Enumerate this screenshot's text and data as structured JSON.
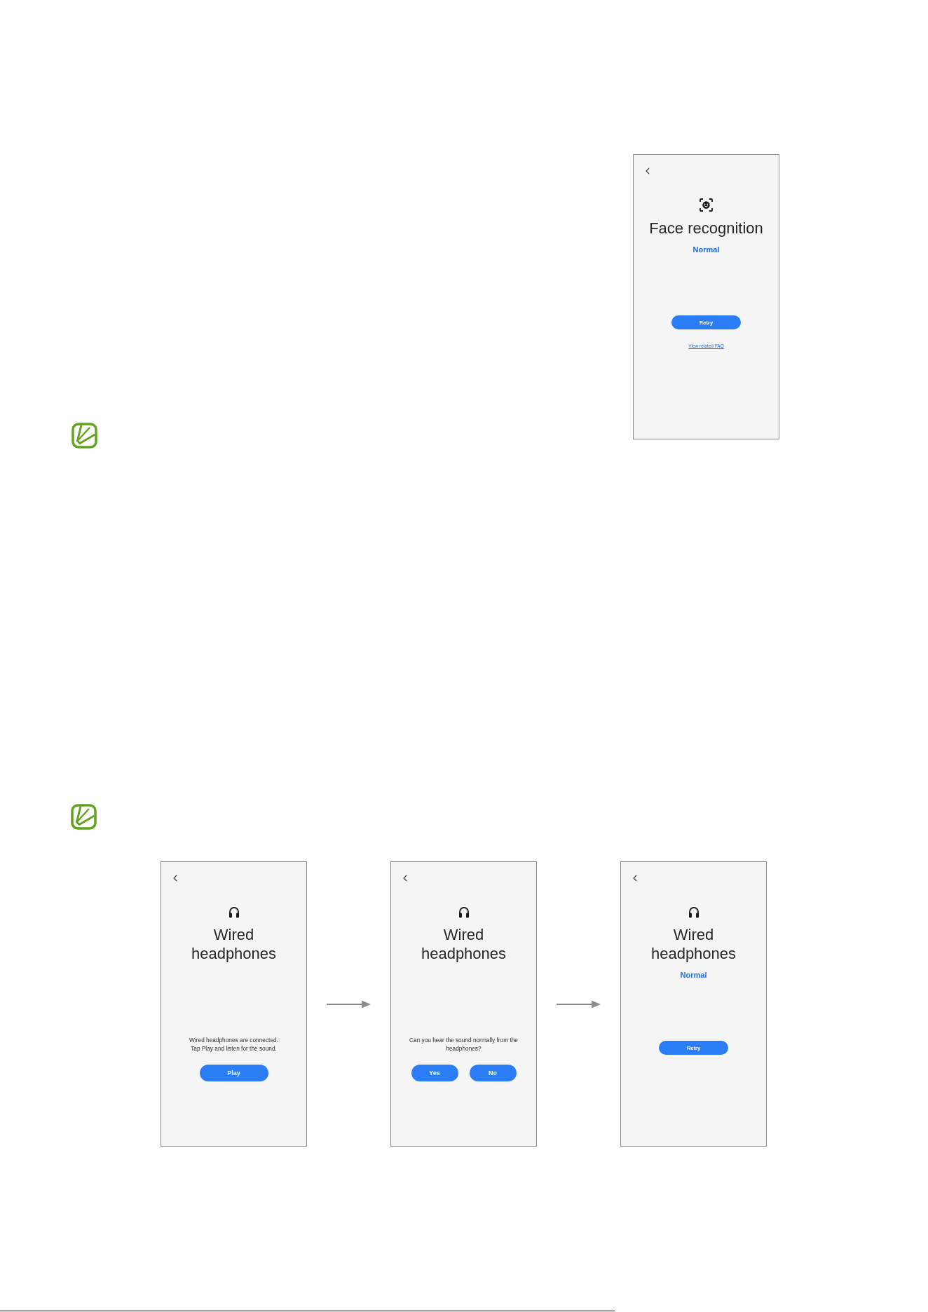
{
  "face_recognition_screen": {
    "kind": "face",
    "title": "Face recognition",
    "status": "Normal",
    "buttons": [
      "Retry"
    ],
    "link": "View related FAQ"
  },
  "wired_headphones_flow": [
    {
      "kind": "headphones",
      "title": "Wired headphones",
      "message": "Wired headphones are connected.\nTap Play and listen for the sound.",
      "buttons": [
        "Play"
      ]
    },
    {
      "kind": "headphones",
      "title": "Wired headphones",
      "message": "Can you hear the sound normally from the headphones?",
      "buttons": [
        "Yes",
        "No"
      ]
    },
    {
      "kind": "headphones",
      "title": "Wired headphones",
      "status": "Normal",
      "buttons": [
        "Retry"
      ]
    }
  ]
}
